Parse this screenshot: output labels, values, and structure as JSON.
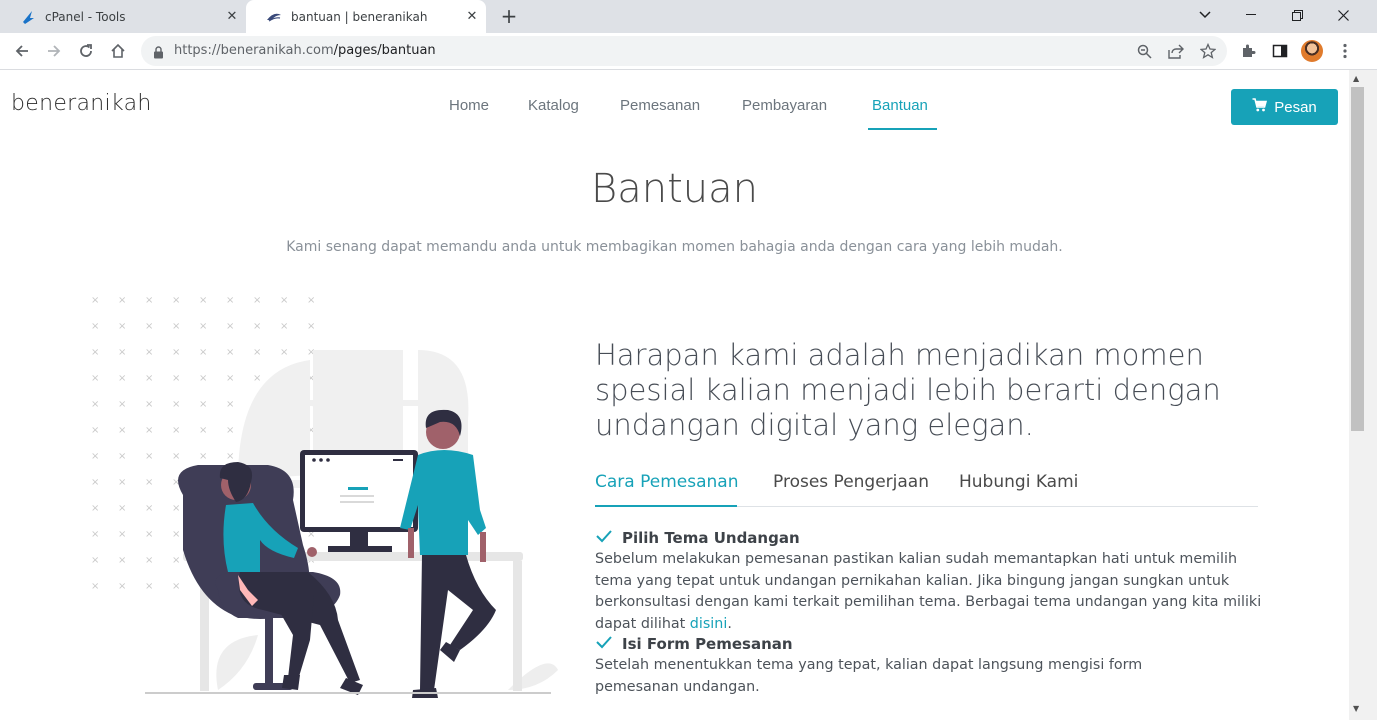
{
  "browser": {
    "tabs": [
      {
        "title": "cPanel - Tools",
        "icon": "cpanel-favicon"
      },
      {
        "title": "bantuan | beneranikah",
        "icon": "site-favicon",
        "active": true
      }
    ],
    "url_host": "https://beneranikah.com",
    "url_path": "/pages/bantuan"
  },
  "site": {
    "logo": "beneranikah",
    "nav": [
      "Home",
      "Katalog",
      "Pemesanan",
      "Pembayaran",
      "Bantuan"
    ],
    "active_nav": "Bantuan",
    "order_button": "Pesan",
    "accent_color": "#17a2b8"
  },
  "hero": {
    "title": "Bantuan",
    "subtitle": "Kami senang dapat memandu anda untuk membagikan momen bahagia anda dengan cara yang lebih mudah."
  },
  "content": {
    "headline": "Harapan kami adalah menjadikan momen spesial kalian menjadi lebih berarti dengan undangan digital yang elegan.",
    "tabs": [
      "Cara Pemesanan",
      "Proses Pengerjaan",
      "Hubungi Kami"
    ],
    "active_tab": "Cara Pemesanan",
    "steps": [
      {
        "title": "Pilih Tema Undangan",
        "text": "Sebelum melakukan pemesanan pastikan kalian sudah memantapkan hati untuk memilih tema yang tepat untuk undangan pernikahan kalian. Jika bingung jangan sungkan untuk berkonsultasi dengan kami terkait pemilihan tema. Berbagai tema undangan yang kita miliki dapat dilihat",
        "link": "disini",
        "suffix": "."
      },
      {
        "title": "Isi Form Pemesanan",
        "text": "Setelah menentukkan tema yang tepat, kalian dapat langsung mengisi form pemesanan undangan."
      }
    ]
  }
}
